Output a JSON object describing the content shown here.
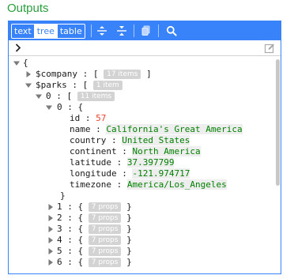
{
  "title": "Outputs",
  "modes": [
    {
      "label": "text",
      "active": false
    },
    {
      "label": "tree",
      "active": true
    },
    {
      "label": "table",
      "active": false
    }
  ],
  "root": {
    "open_bracket": "{",
    "close_bracket": "}"
  },
  "company": {
    "key": "$company",
    "open": "[",
    "close": "]",
    "count": "17 items"
  },
  "parks": {
    "key": "$parks",
    "open": "[",
    "count": "1 item"
  },
  "inner_list": {
    "key": "0",
    "open": "[",
    "count": "11 items"
  },
  "record0": {
    "key": "0",
    "open": "{",
    "close": "}",
    "fields": [
      {
        "name": "id",
        "value": "57",
        "type": "number"
      },
      {
        "name": "name",
        "value": "California's Great America",
        "type": "string"
      },
      {
        "name": "country",
        "value": "United States",
        "type": "string"
      },
      {
        "name": "continent",
        "value": "North America",
        "type": "string"
      },
      {
        "name": "latitude",
        "value": "37.397799",
        "type": "string"
      },
      {
        "name": "longitude",
        "value": "-121.974717",
        "type": "string"
      },
      {
        "name": "timezone",
        "value": "America/Los_Angeles",
        "type": "string"
      }
    ]
  },
  "collapsed_records": [
    {
      "key": "1",
      "open": "{",
      "close": "}",
      "count": "7 props"
    },
    {
      "key": "2",
      "open": "{",
      "close": "}",
      "count": "7 props"
    },
    {
      "key": "3",
      "open": "{",
      "close": "}",
      "count": "7 props"
    },
    {
      "key": "4",
      "open": "{",
      "close": "}",
      "count": "7 props"
    },
    {
      "key": "5",
      "open": "{",
      "close": "}",
      "count": "7 props"
    },
    {
      "key": "6",
      "open": "{",
      "close": "}",
      "count": "7 props"
    }
  ],
  "colon": ":",
  "colors": {
    "title": "#2a9e3e",
    "menu": "#3883fa",
    "string": "#008000",
    "number": "#ee422e",
    "badge": "#d3d3d3"
  },
  "icons": [
    "expand-all-icon",
    "collapse-all-icon",
    "copy-icon",
    "search-icon",
    "chevron-right-icon",
    "edit-icon"
  ]
}
